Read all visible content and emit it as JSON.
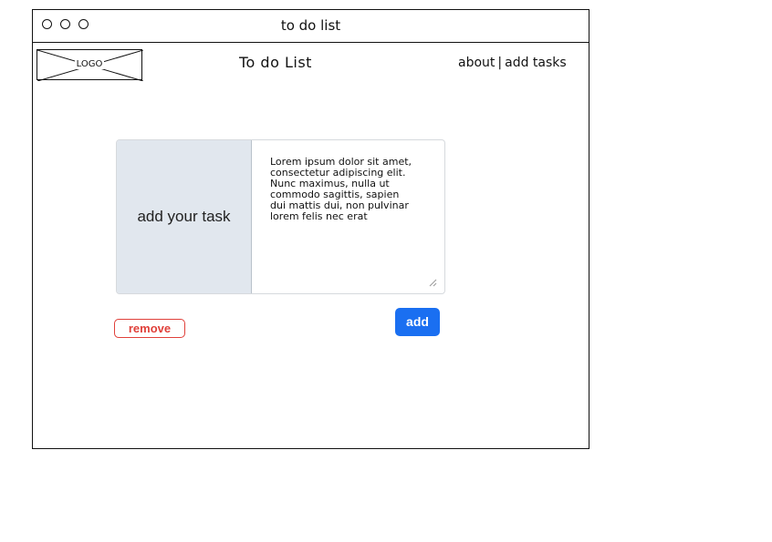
{
  "window": {
    "title": "to do list"
  },
  "header": {
    "logo_text": "LOGO",
    "app_title": "To do List",
    "nav": {
      "about": "about",
      "separator": "|",
      "add_tasks": "add tasks"
    }
  },
  "task": {
    "label": "add your task",
    "text": "Lorem ipsum dolor sit amet, consectetur adipiscing elit. Nunc maximus, nulla ut commodo sagittis, sapien dui mattis dui, non pulvinar lorem felis nec erat"
  },
  "actions": {
    "remove_label": "remove",
    "add_label": "add"
  },
  "colors": {
    "danger": "#e0403a",
    "primary": "#1a6ff1",
    "label_bg": "#e1e7ee"
  }
}
